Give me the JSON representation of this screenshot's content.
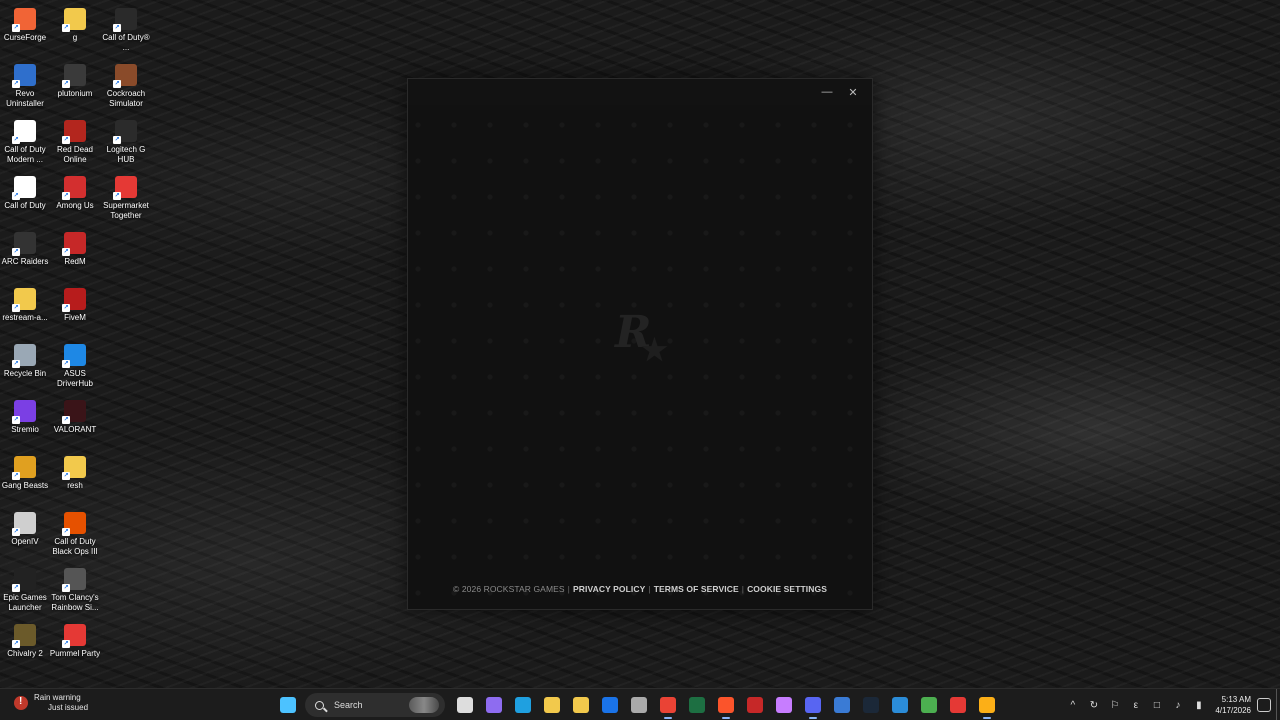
{
  "desktop": {
    "icons": [
      {
        "label": "CurseForge",
        "icon": "curseforge-icon",
        "color": "#f16436"
      },
      {
        "label": "g",
        "icon": "folder-icon",
        "color": "#f2c94c"
      },
      {
        "label": "Call of Duty® ...",
        "icon": "call-of-duty-icon",
        "color": "#2a2a2a"
      },
      {
        "label": "Revo Uninstaller",
        "icon": "revo-uninstaller-icon",
        "color": "#2f6fcc"
      },
      {
        "label": "plutonium",
        "icon": "plutonium-icon",
        "color": "#3a3a3a"
      },
      {
        "label": "Cockroach Simulator",
        "icon": "cockroach-simulator-icon",
        "color": "#8a4b2a"
      },
      {
        "label": "Call of Duty Modern ...",
        "icon": "document-icon",
        "color": "#ffffff"
      },
      {
        "label": "Red Dead Online",
        "icon": "red-dead-online-icon",
        "color": "#b3261e"
      },
      {
        "label": "Logitech G HUB",
        "icon": "logitech-g-hub-icon",
        "color": "#2b2b2b"
      },
      {
        "label": "Call of Duty",
        "icon": "document-icon",
        "color": "#ffffff"
      },
      {
        "label": "Among Us",
        "icon": "among-us-icon",
        "color": "#d32f2f"
      },
      {
        "label": "Supermarket Together",
        "icon": "supermarket-together-icon",
        "color": "#e53935"
      },
      {
        "label": "ARC Raiders",
        "icon": "arc-raiders-icon",
        "color": "#333333"
      },
      {
        "label": "RedM",
        "icon": "redm-icon",
        "color": "#c62828"
      },
      {
        "label": "restream-a...",
        "icon": "folder-icon",
        "color": "#f2c94c"
      },
      {
        "label": "FiveM",
        "icon": "fivem-icon",
        "color": "#b71c1c"
      },
      {
        "label": "Recycle Bin",
        "icon": "recycle-bin-icon",
        "color": "#9aa8b5"
      },
      {
        "label": "ASUS DriverHub",
        "icon": "asus-driverhub-icon",
        "color": "#1e88e5"
      },
      {
        "label": "Stremio",
        "icon": "stremio-icon",
        "color": "#7b3fe4"
      },
      {
        "label": "VALORANT",
        "icon": "valorant-icon",
        "color": "#3a1418"
      },
      {
        "label": "Gang Beasts",
        "icon": "gang-beasts-icon",
        "color": "#e0a020"
      },
      {
        "label": "resh",
        "icon": "folder-icon",
        "color": "#f2c94c"
      },
      {
        "label": "OpenIV",
        "icon": "openiv-icon",
        "color": "#cfcfcf"
      },
      {
        "label": "Call of Duty Black Ops III",
        "icon": "black-ops-iii-icon",
        "color": "#e65100"
      },
      {
        "label": "Epic Games Launcher",
        "icon": "epic-games-icon",
        "color": "#222222"
      },
      {
        "label": "Tom Clancy's Rainbow Si...",
        "icon": "rainbow-six-icon",
        "color": "#555555"
      },
      {
        "label": "Chivalry 2",
        "icon": "chivalry-2-icon",
        "color": "#6b5a2a"
      },
      {
        "label": "Pummel Party",
        "icon": "pummel-party-icon",
        "color": "#e53935"
      }
    ]
  },
  "launcher": {
    "minimize_icon": "minimize-icon",
    "close_icon": "close-icon",
    "logo_glyph": "R",
    "star_glyph": "★",
    "footer": {
      "copyright": "© 2026 ROCKSTAR GAMES",
      "separator": "|",
      "privacy": "PRIVACY POLICY",
      "terms": "TERMS OF SERVICE",
      "cookies": "COOKIE SETTINGS"
    }
  },
  "taskbar": {
    "weather": {
      "title": "Rain warning",
      "subtitle": "Just issued"
    },
    "search_label": "Search",
    "pinned": [
      {
        "icon": "start-icon",
        "color": "#4cc2ff"
      },
      {
        "icon": "task-view-icon",
        "color": "#dddddd"
      },
      {
        "icon": "copilot-icon",
        "color": "#8e6cf0"
      },
      {
        "icon": "edge-icon",
        "color": "#1fa0e0"
      },
      {
        "icon": "file-explorer-icon",
        "color": "#f2c94c"
      },
      {
        "icon": "microsoft-store-icon",
        "color": "#f2c94c"
      },
      {
        "icon": "outlook-icon",
        "color": "#1a73e8"
      },
      {
        "icon": "app-icon",
        "color": "#aaaaaa"
      },
      {
        "icon": "chrome-icon",
        "color": "#ea4335"
      },
      {
        "icon": "excel-icon",
        "color": "#1d6f42"
      },
      {
        "icon": "brave-icon",
        "color": "#fb542b"
      },
      {
        "icon": "fivem-icon",
        "color": "#c62828"
      },
      {
        "icon": "app-icon",
        "color": "#c77dff"
      },
      {
        "icon": "discord-icon",
        "color": "#5865f2"
      },
      {
        "icon": "app-icon",
        "color": "#3a7bd5"
      },
      {
        "icon": "steam-icon",
        "color": "#1b2838"
      },
      {
        "icon": "app-icon",
        "color": "#2b8cd8"
      },
      {
        "icon": "app-icon",
        "color": "#4caf50"
      },
      {
        "icon": "app-icon",
        "color": "#e53935"
      },
      {
        "icon": "rockstar-launcher-icon",
        "color": "#fcaf17"
      }
    ],
    "tray": {
      "chevron": "^",
      "keyboard": "ε",
      "date": "4/17/2026",
      "time": "5:13 AM"
    }
  }
}
